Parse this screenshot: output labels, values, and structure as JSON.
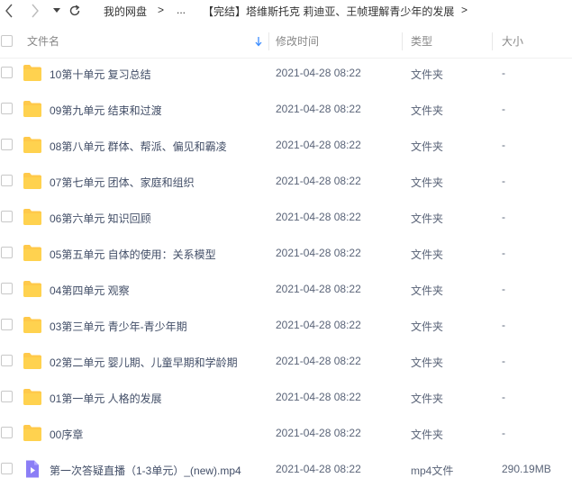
{
  "nav": {
    "breadcrumb": [
      "我的网盘",
      "...",
      "【完结】塔维斯托克 莉迪亚、王帧理解青少年的发展"
    ],
    "separator": ">"
  },
  "header": {
    "name": "文件名",
    "modified": "修改时间",
    "type": "类型",
    "size": "大小"
  },
  "colors": {
    "folder": "#ffc94a",
    "video": "#8b7ef6",
    "sort_arrow": "#3b8cff"
  },
  "files": [
    {
      "name": "10第十单元 复习总结",
      "date": "2021-04-28 08:22",
      "type": "文件夹",
      "size": "-",
      "icon": "folder-icon"
    },
    {
      "name": "09第九单元 结束和过渡",
      "date": "2021-04-28 08:22",
      "type": "文件夹",
      "size": "-",
      "icon": "folder-icon"
    },
    {
      "name": "08第八单元 群体、帮派、偏见和霸凌",
      "date": "2021-04-28 08:22",
      "type": "文件夹",
      "size": "-",
      "icon": "folder-icon"
    },
    {
      "name": "07第七单元 团体、家庭和组织",
      "date": "2021-04-28 08:22",
      "type": "文件夹",
      "size": "-",
      "icon": "folder-icon"
    },
    {
      "name": "06第六单元 知识回顾",
      "date": "2021-04-28 08:22",
      "type": "文件夹",
      "size": "-",
      "icon": "folder-icon"
    },
    {
      "name": "05第五单元 自体的使用：关系模型",
      "date": "2021-04-28 08:22",
      "type": "文件夹",
      "size": "-",
      "icon": "folder-icon"
    },
    {
      "name": "04第四单元 观察",
      "date": "2021-04-28 08:22",
      "type": "文件夹",
      "size": "-",
      "icon": "folder-icon"
    },
    {
      "name": "03第三单元 青少年-青少年期",
      "date": "2021-04-28 08:22",
      "type": "文件夹",
      "size": "-",
      "icon": "folder-icon"
    },
    {
      "name": "02第二单元 婴儿期、儿童早期和学龄期",
      "date": "2021-04-28 08:22",
      "type": "文件夹",
      "size": "-",
      "icon": "folder-icon"
    },
    {
      "name": "01第一单元 人格的发展",
      "date": "2021-04-28 08:22",
      "type": "文件夹",
      "size": "-",
      "icon": "folder-icon"
    },
    {
      "name": "00序章",
      "date": "2021-04-28 08:22",
      "type": "文件夹",
      "size": "-",
      "icon": "folder-icon"
    },
    {
      "name": "第一次答疑直播（1-3单元）_(new).mp4",
      "date": "2021-04-28 08:22",
      "type": "mp4文件",
      "size": "290.19MB",
      "icon": "video-file-icon"
    }
  ]
}
